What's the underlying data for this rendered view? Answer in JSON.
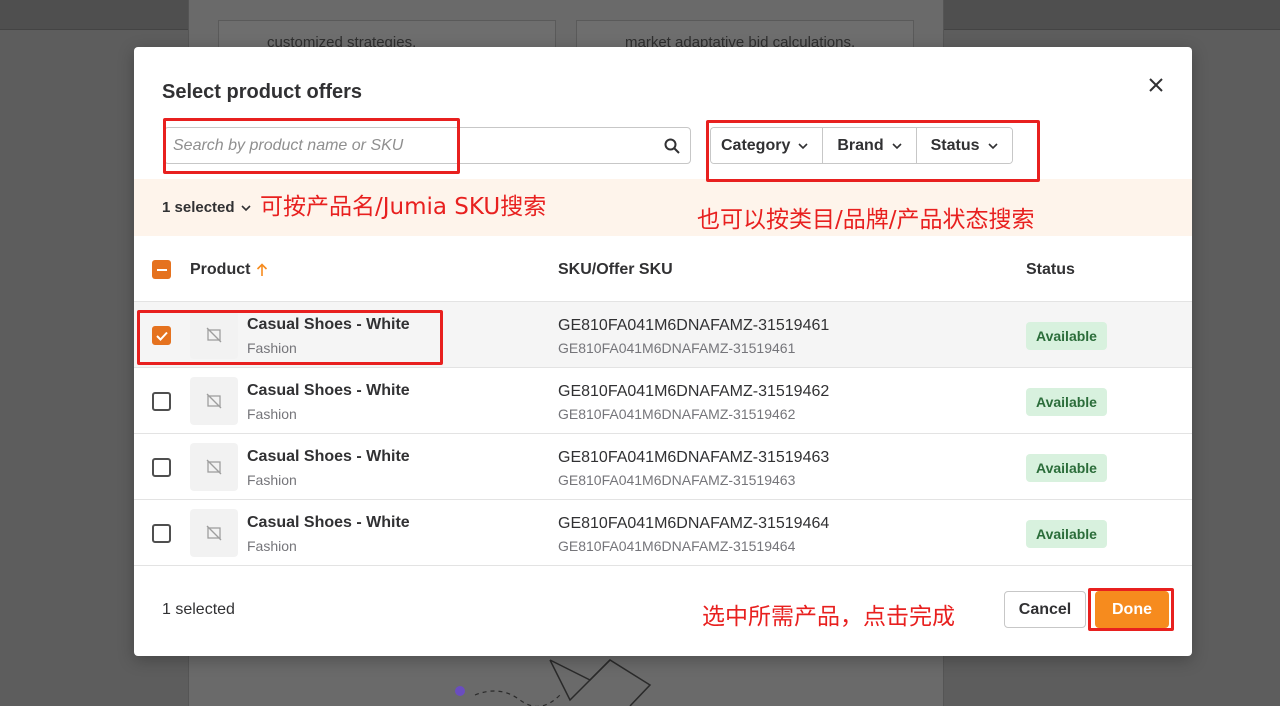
{
  "background": {
    "card_left_text": "customized strategies.",
    "card_right_text": "market adaptative bid calculations."
  },
  "modal": {
    "title": "Select product offers",
    "search": {
      "placeholder": "Search by product name or SKU",
      "value": ""
    },
    "filters": [
      {
        "label": "Category"
      },
      {
        "label": "Brand"
      },
      {
        "label": "Status"
      }
    ],
    "selected_summary": "1 selected",
    "columns": {
      "product": "Product",
      "sku": "SKU/Offer SKU",
      "status": "Status"
    },
    "rows": [
      {
        "name": "Casual Shoes - White",
        "category": "Fashion",
        "sku": "GE810FA041M6DNAFAMZ-31519461",
        "offer_sku": "GE810FA041M6DNAFAMZ-31519461",
        "status": "Available",
        "checked": true
      },
      {
        "name": "Casual Shoes - White",
        "category": "Fashion",
        "sku": "GE810FA041M6DNAFAMZ-31519462",
        "offer_sku": "GE810FA041M6DNAFAMZ-31519462",
        "status": "Available",
        "checked": false
      },
      {
        "name": "Casual Shoes - White",
        "category": "Fashion",
        "sku": "GE810FA041M6DNAFAMZ-31519463",
        "offer_sku": "GE810FA041M6DNAFAMZ-31519463",
        "status": "Available",
        "checked": false
      },
      {
        "name": "Casual Shoes - White",
        "category": "Fashion",
        "sku": "GE810FA041M6DNAFAMZ-31519464",
        "offer_sku": "GE810FA041M6DNAFAMZ-31519464",
        "status": "Available",
        "checked": false
      }
    ],
    "footer": {
      "selected_count": "1 selected",
      "cancel_label": "Cancel",
      "done_label": "Done"
    }
  },
  "annotations": {
    "search_note": "可按产品名/Jumia SKU搜索",
    "filter_note": "也可以按类目/品牌/产品状态搜索",
    "done_note": "选中所需产品，点击完成"
  },
  "colors": {
    "accent": "#f68b1e",
    "checkbox": "#e5721f",
    "annotation": "#e8201f",
    "badge_bg": "#d8f1de"
  }
}
